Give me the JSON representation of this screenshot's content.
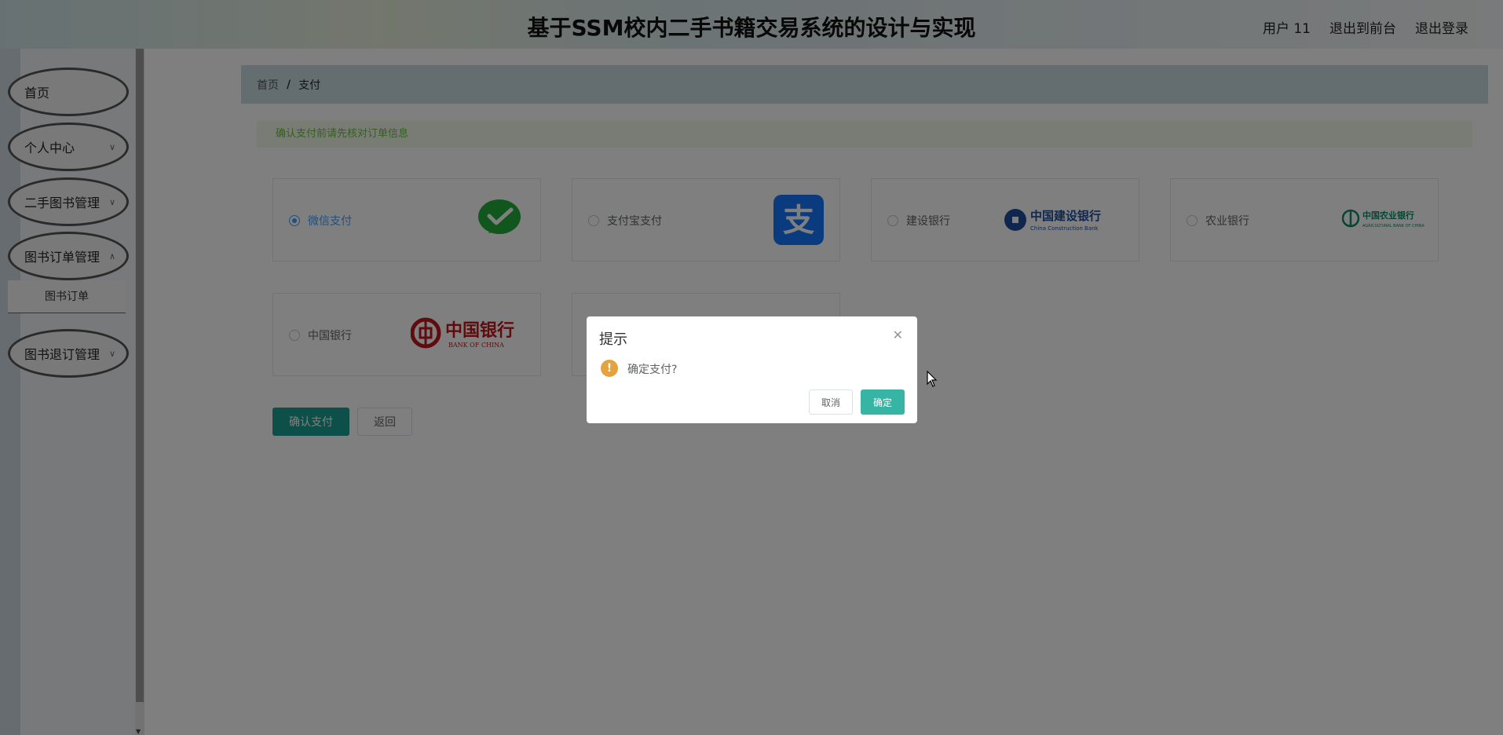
{
  "header": {
    "title": "基于SSM校内二手书籍交易系统的设计与实现",
    "user_label": "用户 11",
    "frontend_link": "退出到前台",
    "logout_link": "退出登录"
  },
  "sidebar": {
    "items": [
      {
        "label": "首页"
      },
      {
        "label": "个人中心"
      },
      {
        "label": "二手图书管理"
      },
      {
        "label": "图书订单管理"
      },
      {
        "label": "图书退订管理"
      }
    ],
    "submenu_item": "图书订单"
  },
  "breadcrumb": {
    "home": "首页",
    "separator": "/",
    "current": "支付"
  },
  "alert": {
    "text": "确认支付前请先核对订单信息"
  },
  "payment": {
    "options": [
      {
        "label": "微信支付",
        "icon": "wechat-pay-icon",
        "checked": true
      },
      {
        "label": "支付宝支付",
        "icon": "alipay-icon",
        "checked": false
      },
      {
        "label": "建设银行",
        "icon": "ccb-logo",
        "checked": false
      },
      {
        "label": "农业银行",
        "icon": "abc-logo",
        "checked": false
      },
      {
        "label": "中国银行",
        "icon": "boc-logo",
        "checked": false
      }
    ],
    "confirm_label": "确认支付",
    "back_label": "返回"
  },
  "logos": {
    "ccb_cn": "中国建设银行",
    "ccb_en": "China Construction Bank",
    "abc_cn": "中国农业银行",
    "abc_en": "AGRICULTURAL BANK OF CHINA",
    "boc_cn": "中国银行",
    "boc_en": "BANK OF CHINA"
  },
  "dialog": {
    "title": "提示",
    "message": "确定支付?",
    "cancel_label": "取消",
    "ok_label": "确定"
  },
  "colors": {
    "primary": "#1aa094",
    "dialog_ok": "#36b5a5",
    "warning": "#e6a23c",
    "radio_checked": "#409eff"
  }
}
